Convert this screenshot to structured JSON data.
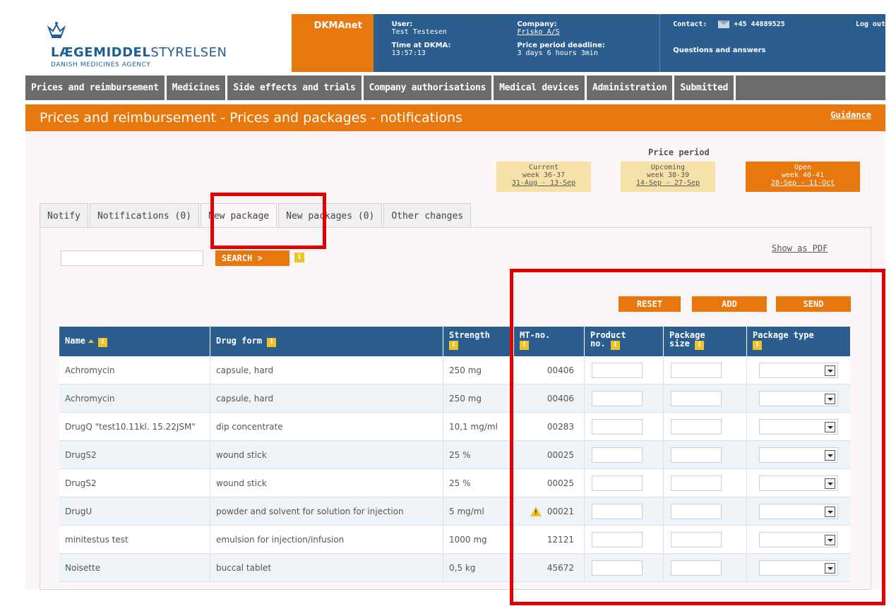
{
  "header": {
    "logo_title_bold": "LÆGEMIDDEL",
    "logo_title_rest": "STYRELSEN",
    "logo_subtitle": "DANISH MEDICINES AGENCY",
    "app_name": "DKMAnet",
    "user_label": "User:",
    "user_value": "Test Testesen",
    "time_label": "Time at DKMA:",
    "time_value": "13:57:13",
    "company_label": "Company:",
    "company_value": "Frisko A/S",
    "deadline_label": "Price period deadline:",
    "deadline_value": "3 days 6 hours 3min",
    "contact_label": "Contact:",
    "contact_phone": "+45 44889525",
    "logout": "Log out",
    "qa": "Questions and answers"
  },
  "nav": [
    "Prices and reimbursement",
    "Medicines",
    "Side effects and trials",
    "Company authorisations",
    "Medical devices",
    "Administration",
    "Submitted"
  ],
  "page": {
    "title": "Prices and reimbursement - Prices and packages - notifications",
    "guidance": "Guidance"
  },
  "price_period": {
    "label": "Price period",
    "current": {
      "title": "Current",
      "week": "week 36-37",
      "range": "31-Aug - 13-Sep"
    },
    "upcoming": {
      "title": "Upcoming",
      "week": "week 38-39",
      "range": "14-Sep - 27-Sep"
    },
    "open": {
      "title": "Open",
      "week": "week 40-41",
      "range": "28-Sep - 11-Oct"
    }
  },
  "tabs": [
    "Notify",
    "Notifications (0)",
    "New package",
    "New packages (0)",
    "Other changes"
  ],
  "search": {
    "button": "SEARCH >",
    "value": ""
  },
  "show_pdf": "Show as PDF",
  "actions": {
    "reset": "RESET",
    "add": "ADD",
    "send": "SEND"
  },
  "table": {
    "headers": {
      "name": "Name",
      "drug_form": "Drug form",
      "strength": "Strength",
      "mt_no": "MT-no.",
      "product_no_1": "Product",
      "product_no_2": "no.",
      "package_size_1": "Package",
      "package_size_2": "size",
      "package_type": "Package type"
    },
    "rows": [
      {
        "name": "Achromycin",
        "form": "capsule, hard",
        "strength": "250 mg",
        "mt": "00406"
      },
      {
        "name": "Achromycin",
        "form": "capsule, hard",
        "strength": "250 mg",
        "mt": "00406"
      },
      {
        "name": "DrugQ \"test10.11kl. 15.22JSM\"",
        "form": "dip concentrate",
        "strength": "10,1 mg/ml",
        "mt": "00283"
      },
      {
        "name": "DrugS2",
        "form": "wound stick",
        "strength": "25 %",
        "mt": "00025"
      },
      {
        "name": "DrugS2",
        "form": "wound stick",
        "strength": "25 %",
        "mt": "00025"
      },
      {
        "name": "DrugU",
        "form": "powder and solvent for solution for injection",
        "strength": "5 mg/ml",
        "mt": "00021"
      },
      {
        "name": "minitestus test",
        "form": "emulsion for injection/infusion",
        "strength": "1000 mg",
        "mt": "12121"
      },
      {
        "name": "Noisette",
        "form": "buccal tablet",
        "strength": "0,5 kg",
        "mt": "45672"
      }
    ]
  },
  "colors": {
    "brand_blue": "#2b5e8e",
    "orange": "#e8780d",
    "highlight_red": "#e00000",
    "period_yellow": "#f6e2a8"
  }
}
